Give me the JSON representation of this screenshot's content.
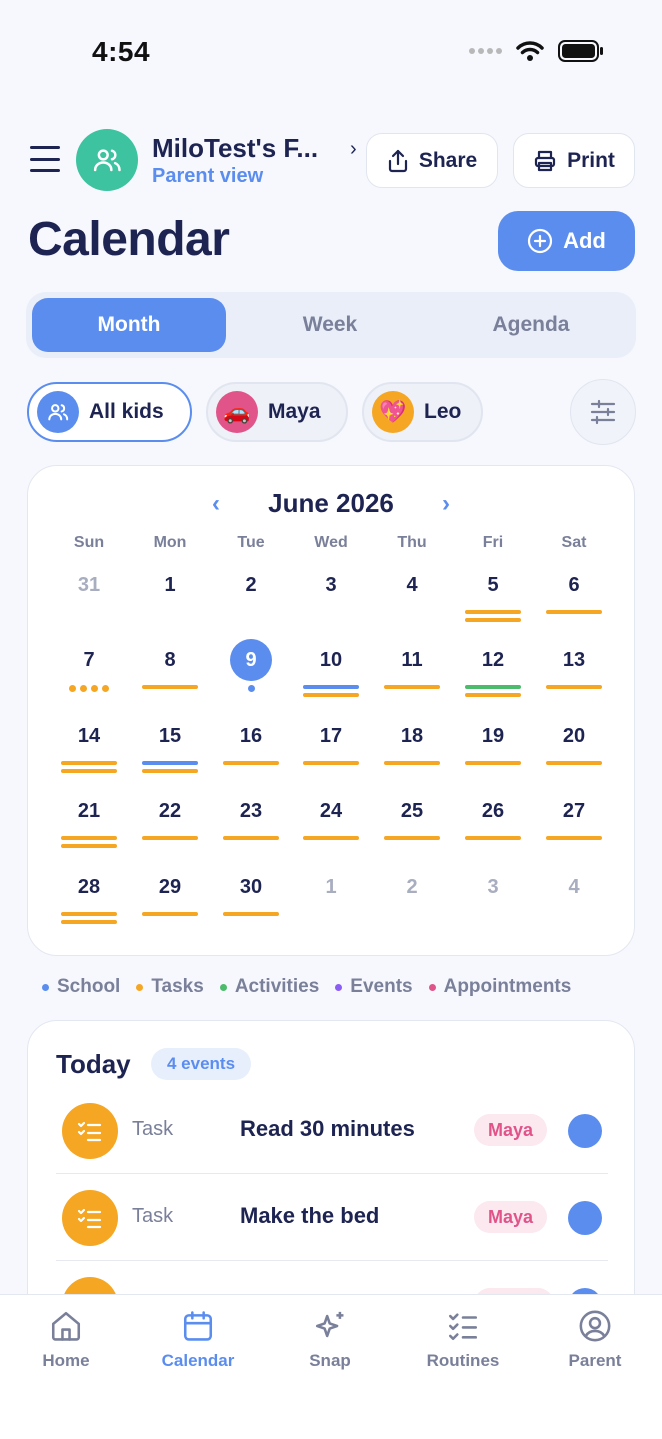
{
  "status": {
    "time": "4:54"
  },
  "header": {
    "family_name": "MiloTest's F...",
    "family_sub": "Parent view",
    "share_label": "Share",
    "print_label": "Print"
  },
  "page": {
    "title": "Calendar",
    "add_label": "Add"
  },
  "view_tabs": [
    {
      "label": "Month",
      "active": true
    },
    {
      "label": "Week",
      "active": false
    },
    {
      "label": "Agenda",
      "active": false
    }
  ],
  "kid_filters": [
    {
      "label": "All kids",
      "active": true,
      "icon": "users-icon"
    },
    {
      "label": "Maya",
      "active": false,
      "emoji": "🚗"
    },
    {
      "label": "Leo",
      "active": false,
      "emoji": "💖"
    }
  ],
  "calendar": {
    "month_title": "June 2026",
    "weekdays": [
      "Sun",
      "Mon",
      "Tue",
      "Wed",
      "Thu",
      "Fri",
      "Sat"
    ],
    "colors": {
      "school": "#5B8DEF",
      "tasks": "#F5A623",
      "activities": "#4CBB6C",
      "events": "#8B5CF6",
      "appointments": "#E0548A"
    },
    "weeks": [
      [
        {
          "d": "31",
          "muted": true,
          "bars": []
        },
        {
          "d": "1",
          "bars": []
        },
        {
          "d": "2",
          "bars": []
        },
        {
          "d": "3",
          "bars": []
        },
        {
          "d": "4",
          "bars": []
        },
        {
          "d": "5",
          "bars": [
            "tasks",
            "tasks"
          ]
        },
        {
          "d": "6",
          "bars": [
            "tasks"
          ]
        }
      ],
      [
        {
          "d": "7",
          "dots": [
            "tasks",
            "tasks",
            "tasks",
            "tasks"
          ]
        },
        {
          "d": "8",
          "bars": [
            "tasks"
          ]
        },
        {
          "d": "9",
          "today": true,
          "dots": [
            "school"
          ]
        },
        {
          "d": "10",
          "bars": [
            "school",
            "tasks"
          ]
        },
        {
          "d": "11",
          "bars": [
            "tasks"
          ]
        },
        {
          "d": "12",
          "bars": [
            "activities",
            "tasks"
          ]
        },
        {
          "d": "13",
          "bars": [
            "tasks"
          ]
        }
      ],
      [
        {
          "d": "14",
          "bars": [
            "tasks",
            "tasks"
          ]
        },
        {
          "d": "15",
          "bars": [
            "school",
            "tasks"
          ]
        },
        {
          "d": "16",
          "bars": [
            "tasks"
          ]
        },
        {
          "d": "17",
          "bars": [
            "tasks"
          ]
        },
        {
          "d": "18",
          "bars": [
            "tasks"
          ]
        },
        {
          "d": "19",
          "bars": [
            "tasks"
          ]
        },
        {
          "d": "20",
          "bars": [
            "tasks"
          ]
        }
      ],
      [
        {
          "d": "21",
          "bars": [
            "tasks",
            "tasks"
          ]
        },
        {
          "d": "22",
          "bars": [
            "tasks"
          ]
        },
        {
          "d": "23",
          "bars": [
            "tasks"
          ]
        },
        {
          "d": "24",
          "bars": [
            "tasks"
          ]
        },
        {
          "d": "25",
          "bars": [
            "tasks"
          ]
        },
        {
          "d": "26",
          "bars": [
            "tasks"
          ]
        },
        {
          "d": "27",
          "bars": [
            "tasks"
          ]
        }
      ],
      [
        {
          "d": "28",
          "bars": [
            "tasks",
            "tasks"
          ]
        },
        {
          "d": "29",
          "bars": [
            "tasks"
          ]
        },
        {
          "d": "30",
          "bars": [
            "tasks"
          ]
        },
        {
          "d": "1",
          "muted": true,
          "bars": []
        },
        {
          "d": "2",
          "muted": true,
          "bars": []
        },
        {
          "d": "3",
          "muted": true,
          "bars": []
        },
        {
          "d": "4",
          "muted": true,
          "bars": []
        }
      ]
    ]
  },
  "legend": [
    {
      "label": "School",
      "color": "#5B8DEF"
    },
    {
      "label": "Tasks",
      "color": "#F5A623"
    },
    {
      "label": "Activities",
      "color": "#4CBB6C"
    },
    {
      "label": "Events",
      "color": "#8B5CF6"
    },
    {
      "label": "Appointments",
      "color": "#E0548A"
    }
  ],
  "today": {
    "title": "Today",
    "badge": "4 events",
    "events": [
      {
        "type": "Task",
        "title": "Read 30 minutes",
        "kid": "Maya"
      },
      {
        "type": "Task",
        "title": "Make the bed",
        "kid": "Maya"
      },
      {
        "type": "",
        "title": "",
        "kid": ""
      }
    ]
  },
  "tabbar": [
    {
      "label": "Home",
      "icon": "home-icon",
      "active": false
    },
    {
      "label": "Calendar",
      "icon": "calendar-icon",
      "active": true
    },
    {
      "label": "Snap",
      "icon": "sparkle-icon",
      "active": false
    },
    {
      "label": "Routines",
      "icon": "checklist-icon",
      "active": false
    },
    {
      "label": "Parent",
      "icon": "user-circle-icon",
      "active": false
    }
  ]
}
